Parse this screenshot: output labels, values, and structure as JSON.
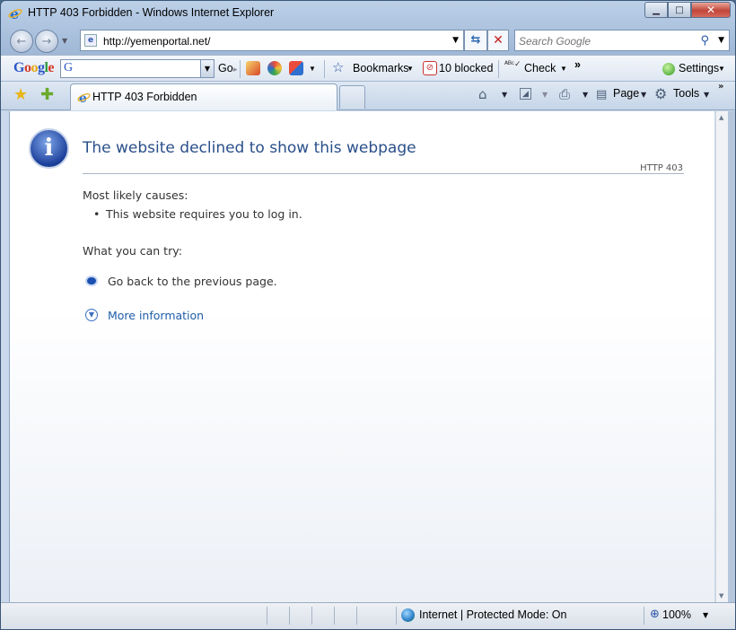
{
  "window": {
    "title": "HTTP 403 Forbidden - Windows Internet Explorer",
    "minimize_glyph": "▁",
    "maximize_glyph": "□",
    "close_glyph": "✕"
  },
  "address_bar": {
    "url": "http://yemenportal.net/",
    "search_placeholder": "Search Google"
  },
  "google_toolbar": {
    "logo": "Google",
    "search_value": "G",
    "go_label": "Go",
    "bookmarks_label": "Bookmarks",
    "popup_blocked_label": "10 blocked",
    "check_label": "Check",
    "more_chevron": "»",
    "settings_label": "Settings"
  },
  "tabs": {
    "active_title": "HTTP 403 Forbidden"
  },
  "command_bar": {
    "page_label": "Page",
    "tools_label": "Tools",
    "more_chevron": "»"
  },
  "error_page": {
    "headline": "The website declined to show this webpage",
    "status_code": "HTTP 403",
    "causes_heading": "Most likely causes:",
    "causes": [
      "This website requires you to log in."
    ],
    "try_heading": "What you can try:",
    "try_items": [
      "Go back to the previous page."
    ],
    "more_info_link": "More information"
  },
  "status_bar": {
    "zone": "Internet | Protected Mode: On",
    "zoom": "100%"
  },
  "icons": {
    "info": "info-circle-icon",
    "ie": "internet-explorer-icon",
    "globe": "internet-zone-globe-icon",
    "favorites": "favorites-star-icon",
    "add_favorite": "add-favorite-star-icon"
  },
  "colors": {
    "headline": "#2a4f8a",
    "link": "#1f5ea8",
    "info_icon": "#1b3f9a"
  }
}
